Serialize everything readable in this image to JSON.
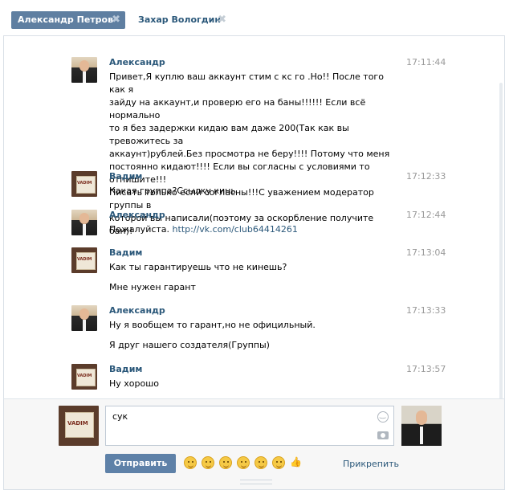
{
  "tabs": [
    {
      "label": "Александр Петров",
      "close": "✖"
    },
    {
      "label": "Захар Вологдин",
      "close": "✖"
    }
  ],
  "messages": [
    {
      "author": "Александр",
      "time": "17:11:44",
      "text": "Привет,Я куплю ваш аккаунт стим с кс го .Но!! После того как я\nзайду на аккаунт,и проверю его на баны!!!!!! Если всё нормально\nто я без задержки кидаю вам даже 200(Так как вы тревожитесь за\nаккаунт)рублей.Без просмотра не беру!!!! Потому что меня\nпостоянно кидают!!!! Если вы согласны с условиями то отпишите!!!\nПисать только если согласны!!!С уважением модератор группы в\nкоторой вы написали(поэтому за оскорбление получите бан)!"
    },
    {
      "author": "Вадим",
      "time": "17:12:33",
      "text": "Какая группа?Ссылку кинь"
    },
    {
      "author": "Александр",
      "time": "17:12:44",
      "text_prefix": "Пожалуйста. ",
      "link": "http://vk.com/club64414261"
    },
    {
      "author": "Вадим",
      "time": "17:13:04",
      "text": "Как ты гарантируешь что не кинешь?",
      "text2": "Мне нужен гарант"
    },
    {
      "author": "Александр",
      "time": "17:13:33",
      "text": "Ну я вообщем то гарант,но не официльный.",
      "text2": "Я друг нашего создателя(Группы)"
    },
    {
      "author": "Вадим",
      "time": "17:13:57",
      "text": "Ну хорошо"
    }
  ],
  "composer": {
    "input_value": "сук",
    "send_label": "Отправить",
    "attach_label": "Прикрепить"
  },
  "icons": {
    "emoji": [
      "smirk-emoji",
      "blush-emoji",
      "laugh-emoji",
      "grin-emoji",
      "wink-emoji",
      "shock-emoji",
      "thumbs-up-emoji"
    ]
  }
}
